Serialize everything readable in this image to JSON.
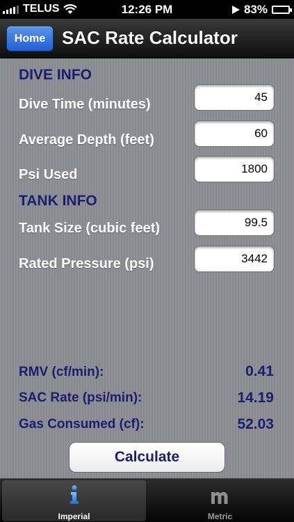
{
  "status_bar": {
    "carrier": "TELUS",
    "time": "12:26 PM",
    "battery": "83%",
    "battery_level": 0.83
  },
  "nav": {
    "home_label": "Home",
    "title": "SAC Rate Calculator"
  },
  "dive_info": {
    "heading": "DIVE INFO",
    "dive_time_label": "Dive Time (minutes)",
    "dive_time_value": "45",
    "avg_depth_label": "Average Depth (feet)",
    "avg_depth_value": "60",
    "psi_used_label": "Psi Used",
    "psi_used_value": "1800"
  },
  "tank_info": {
    "heading": "TANK INFO",
    "tank_size_label": "Tank Size (cubic feet)",
    "tank_size_value": "99.5",
    "rated_pressure_label": "Rated Pressure (psi)",
    "rated_pressure_value": "3442"
  },
  "results": {
    "rmv_label": "RMV (cf/min):",
    "rmv_value": "0.41",
    "sac_label": "SAC Rate (psi/min):",
    "sac_value": "14.19",
    "gas_label": "Gas Consumed (cf):",
    "gas_value": "52.03"
  },
  "calculate_label": "Calculate",
  "tabs": [
    {
      "label": "Imperial",
      "icon": "info-i-icon",
      "selected": true
    },
    {
      "label": "Metric",
      "icon": "metric-m-icon",
      "selected": false
    }
  ],
  "colors": {
    "heading_navy": "#1b1d6e",
    "home_button_blue": "#2f6fd9",
    "tab_icon_blue": "#3b8de3"
  }
}
